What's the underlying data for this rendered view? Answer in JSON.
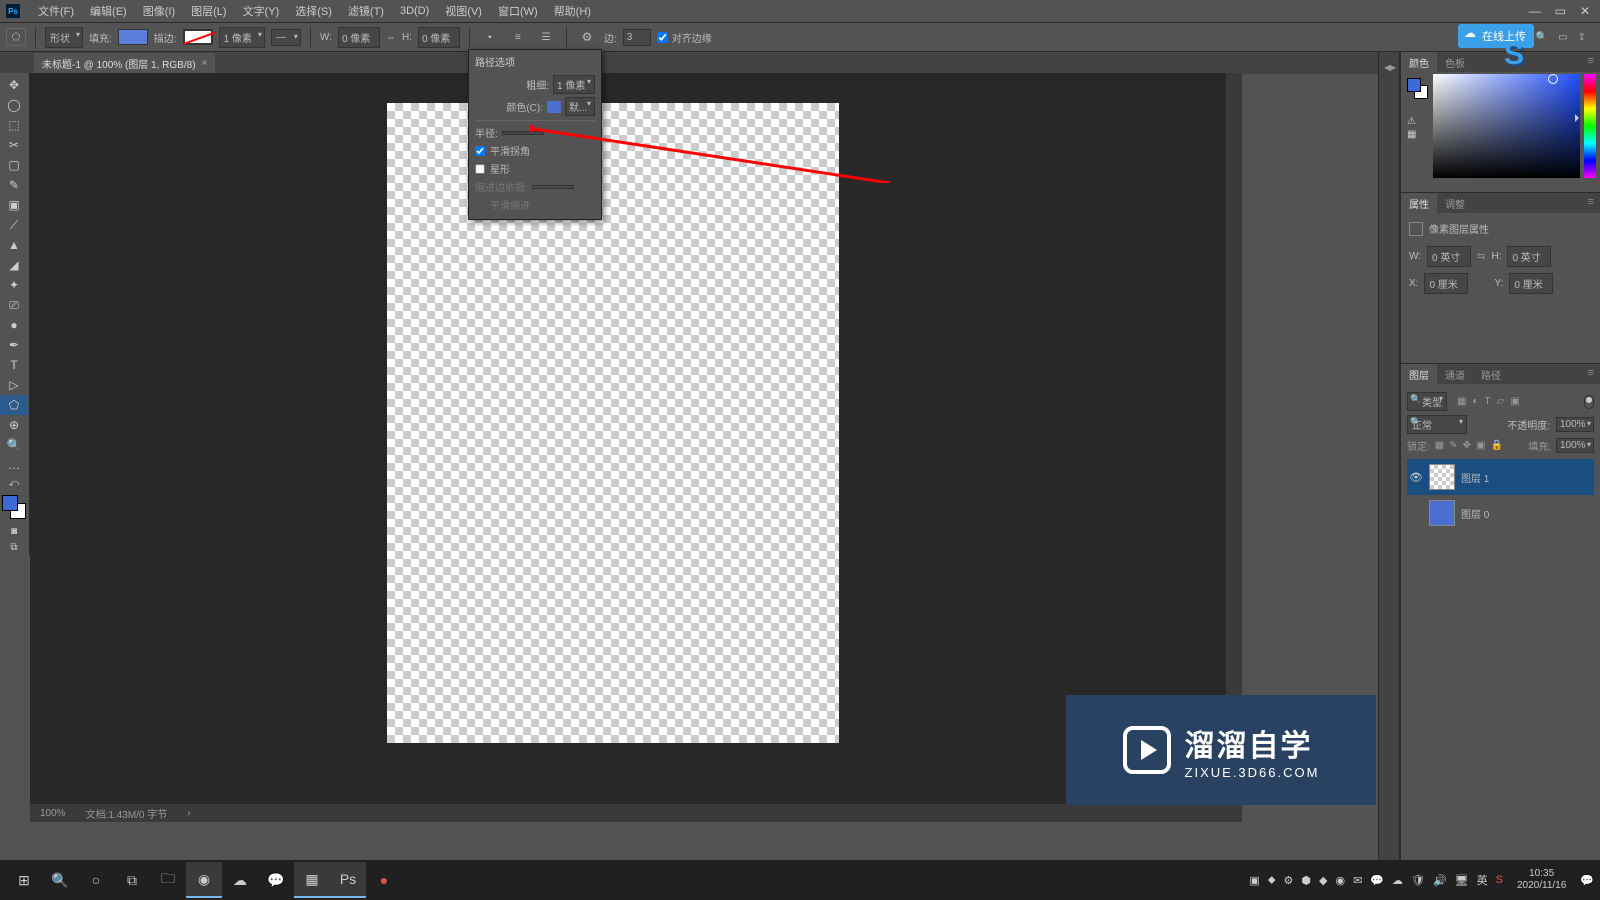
{
  "menu": [
    "文件(F)",
    "编辑(E)",
    "图像(I)",
    "图层(L)",
    "文字(Y)",
    "选择(S)",
    "滤镜(T)",
    "3D(D)",
    "视图(V)",
    "窗口(W)",
    "帮助(H)"
  ],
  "optbar": {
    "shape_mode": "形状",
    "fill_label": "填充:",
    "stroke_label": "描边:",
    "stroke_width": "1 像素",
    "w_label": "W:",
    "w_val": "0 像素",
    "h_label": "H:",
    "h_val": "0 像素",
    "link": "⇔",
    "sides_label": "边:",
    "sides_val": "3",
    "align_edges": "对齐边缘"
  },
  "upload_badge": "在线上传",
  "tab": {
    "title": "未标题-1 @ 100% (图层 1, RGB/8)",
    "close": "×"
  },
  "tools": [
    "✥",
    "◯",
    "⬚",
    "✂",
    "▢",
    "✎",
    "▣",
    "⟋",
    "▲",
    "◢",
    "✦",
    "⎚",
    "●",
    "✒",
    "T",
    "▷",
    "✋",
    "⊕",
    "🔍",
    "…"
  ],
  "popup": {
    "title": "路径选项",
    "thickness_label": "粗细:",
    "thickness_val": "1 像素",
    "color_label": "颜色(C):",
    "color_val": "默...",
    "radius_label": "半径:",
    "radius_val": "",
    "smooth": "平滑拐角",
    "star": "星形",
    "indent_label": "缩进边依据:",
    "indent_val": "",
    "smooth_indent": "平滑缩进"
  },
  "statusbar": {
    "zoom": "100%",
    "doc_info": "文档:1.43M/0 字节"
  },
  "panels": {
    "color": {
      "tabs": [
        "颜色",
        "色板"
      ]
    },
    "props": {
      "tabs": [
        "属性",
        "调整"
      ],
      "title": "像素图层属性",
      "w_label": "W:",
      "w": "0 英寸",
      "h_label": "H:",
      "h": "0 英寸",
      "x_label": "X:",
      "x": "0 厘米",
      "y_label": "Y:",
      "y": "0 厘米"
    },
    "layers": {
      "tabs": [
        "图层",
        "通道",
        "路径"
      ],
      "kind": "类型",
      "blend": "正常",
      "opacity_label": "不透明度:",
      "opacity_val": "100%",
      "lock_label": "锁定:",
      "fill_label": "填充:",
      "fill_val": "100%",
      "items": [
        {
          "name": "图层 1",
          "visible": true,
          "thumb": "checker"
        },
        {
          "name": "图层 0",
          "visible": false,
          "thumb": "blue"
        }
      ]
    }
  },
  "watermark": {
    "big": "溜溜自学",
    "small": "ZIXUE.3D66.COM"
  },
  "taskbar": {
    "time": "10:35",
    "date": "2020/11/16",
    "ime": "英"
  }
}
